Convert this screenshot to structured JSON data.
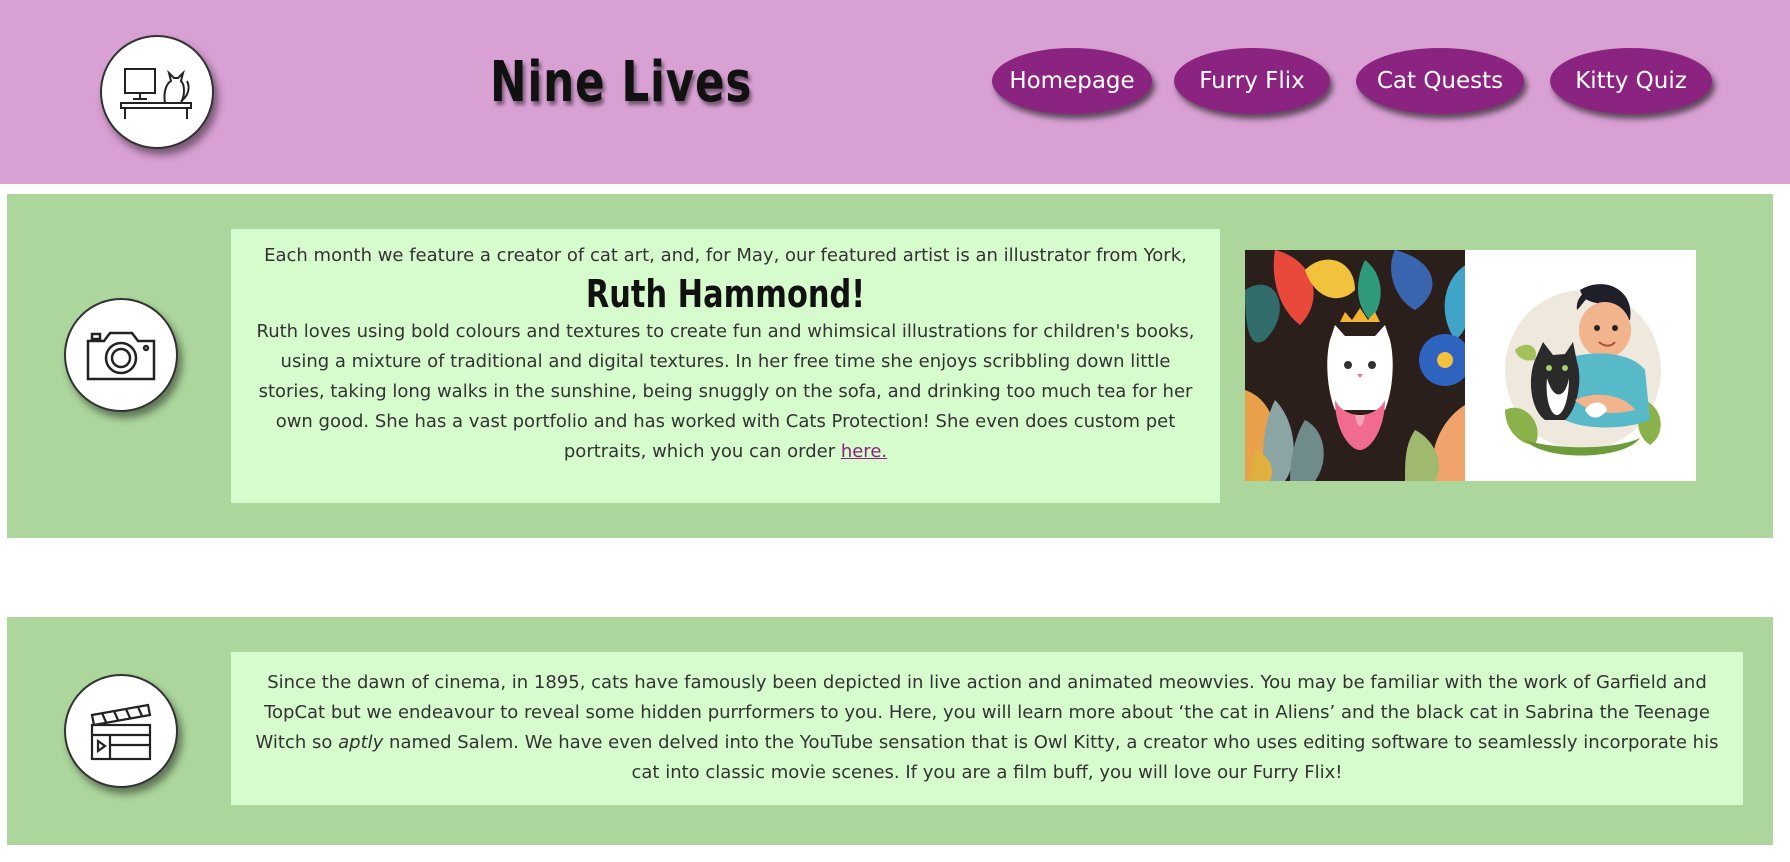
{
  "header": {
    "title": "Nine Lives",
    "logo_icon": "cat-on-desk-icon"
  },
  "nav": [
    {
      "label": "Homepage"
    },
    {
      "label": "Furry Flix"
    },
    {
      "label": "Cat Quests"
    },
    {
      "label": "Kitty Quiz"
    }
  ],
  "artist_section": {
    "icon": "camera-icon",
    "intro": "Each month we feature a creator of cat art, and, for May, our featured artist is an illustrator from York,",
    "artist_name": "Ruth Hammond!",
    "body": "Ruth loves using bold colours and textures to create fun and whimsical illustrations for children's books, using a mixture of traditional and digital textures. In her free time she enjoys scribbling down little stories, taking long walks in the sunshine, being snuggly on the sofa, and drinking too much tea for her own good. She has a vast portfolio and has worked with Cats Protection! She even does custom pet portraits, which you can order",
    "link_text": "here.",
    "images": [
      "cat-with-crown-illustration",
      "child-hugging-cat-illustration"
    ]
  },
  "film_section": {
    "icon": "clapperboard-icon",
    "text_before": "Since the dawn of cinema, in 1895, cats have famously been depicted in live action and animated meowvies. You may be familiar with the work of Garfield and TopCat but we endeavour to reveal some hidden purrformers to you. Here, you will learn more about ‘the cat in Aliens’ and the black cat in Sabrina the Teenage Witch so",
    "emphasis": "aptly",
    "text_after": "named Salem. We have even delved into the YouTube sensation that is Owl Kitty, a creator who uses editing software to seamlessly incorporate his cat into classic movie scenes. If you are a film buff, you will love our Furry Flix!"
  },
  "colors": {
    "header_bg": "#d8a0d3",
    "nav_button": "#8b2380",
    "section_bg": "#acd69c",
    "text_box_bg": "#d6fbcd"
  }
}
